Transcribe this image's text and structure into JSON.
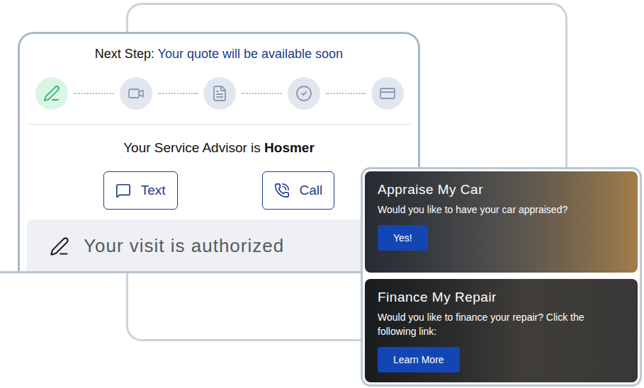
{
  "progress": {
    "label": "Next Step:",
    "value": "Your quote will be available soon"
  },
  "steps": [
    {
      "kind": "sign",
      "selected": true
    },
    {
      "kind": "video",
      "selected": false
    },
    {
      "kind": "document",
      "selected": false
    },
    {
      "kind": "approve",
      "selected": false
    },
    {
      "kind": "payment",
      "selected": false
    }
  ],
  "advisor": {
    "label": "Your Service Advisor is",
    "name": "Hosmer"
  },
  "contact_buttons": [
    {
      "label": "Text",
      "kind": "text"
    },
    {
      "label": "Call",
      "kind": "call"
    }
  ],
  "status": {
    "text": "Your visit is authorized"
  },
  "offers": [
    {
      "title": "Appraise My Car",
      "text": "Would you like to have your car appraised?",
      "button": "Yes!",
      "kind": "appraise"
    },
    {
      "title": "Finance My Repair",
      "text": "Would you like to finance your repair? Click the following link:",
      "button": "Learn More",
      "kind": "finance"
    }
  ]
}
